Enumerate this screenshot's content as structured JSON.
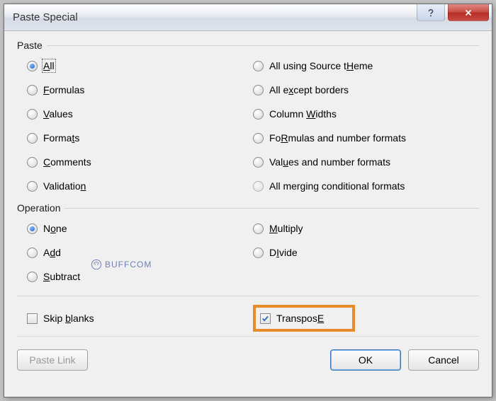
{
  "title": "Paste Special",
  "groups": {
    "paste": {
      "legend": "Paste",
      "left": [
        {
          "label": "All",
          "u": "A",
          "rest": "ll",
          "selected": true,
          "focus": true
        },
        {
          "label": "Formulas",
          "u": "F",
          "rest": "ormulas"
        },
        {
          "label": "Values",
          "u": "V",
          "rest": "alues"
        },
        {
          "label": "Formats",
          "u": "t",
          "pre": "Forma",
          "rest": "s"
        },
        {
          "label": "Comments",
          "u": "C",
          "rest": "omments"
        },
        {
          "label": "Validation",
          "u": "n",
          "pre": "Validatio",
          "rest": ""
        }
      ],
      "right": [
        {
          "label": "All using Source theme",
          "u": "H",
          "pre": "All using Source t",
          "rest": "eme"
        },
        {
          "label": "All except borders",
          "u": "x",
          "pre": "All e",
          "rest": "cept borders"
        },
        {
          "label": "Column widths",
          "u": "W",
          "pre": "Column ",
          "rest": "idths"
        },
        {
          "label": "Formulas and number formats",
          "u": "R",
          "pre": "Fo",
          "rest": "mulas and number formats"
        },
        {
          "label": "Values and number formats",
          "u": "u",
          "pre": "Val",
          "rest": "es and number formats"
        },
        {
          "label": "All merging conditional formats",
          "disabled": true
        }
      ]
    },
    "operation": {
      "legend": "Operation",
      "left": [
        {
          "label": "None",
          "u": "o",
          "pre": "N",
          "rest": "ne",
          "selected": true
        },
        {
          "label": "Add",
          "u": "d",
          "pre": "A",
          "rest": "d"
        },
        {
          "label": "Subtract",
          "u": "S",
          "rest": "ubtract"
        }
      ],
      "right": [
        {
          "label": "Multiply",
          "u": "M",
          "rest": "ultiply"
        },
        {
          "label": "Divide",
          "u": "I",
          "pre": "D",
          "rest": "vide"
        }
      ]
    }
  },
  "checks": {
    "skip_blanks": {
      "label": "Skip blanks",
      "u": "b",
      "pre": "Skip ",
      "rest": "lanks",
      "checked": false
    },
    "transpose": {
      "label": "Transpose",
      "u": "E",
      "pre": "Transpos",
      "rest": "",
      "checked": true,
      "highlight": true
    }
  },
  "buttons": {
    "paste_link": "Paste Link",
    "ok": "OK",
    "cancel": "Cancel"
  },
  "watermark": "BUFFCOM"
}
